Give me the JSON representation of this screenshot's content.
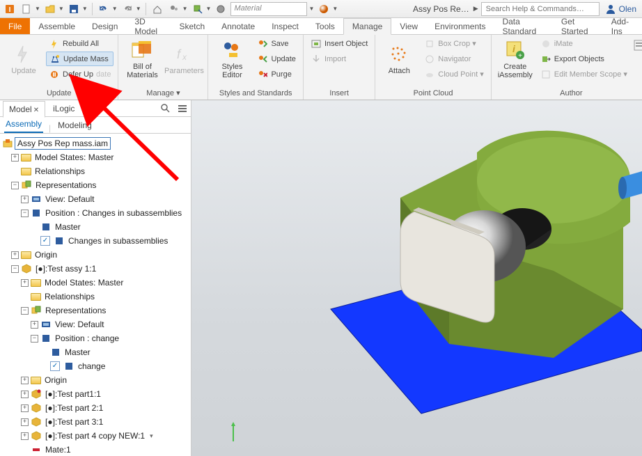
{
  "qat": {
    "material_placeholder": "Material",
    "doc_name": "Assy Pos Re…",
    "search_placeholder": "Search Help & Commands…",
    "user_name": "Olen"
  },
  "tabs": {
    "file": "File",
    "list": [
      "Assemble",
      "Design",
      "3D Model",
      "Sketch",
      "Annotate",
      "Inspect",
      "Tools",
      "Manage",
      "View",
      "Environments",
      "Data Standard",
      "Get Started",
      "Add-Ins"
    ],
    "active": "Manage"
  },
  "ribbon": {
    "update": {
      "big": "Update",
      "rebuild_all": "Rebuild All",
      "update_mass": "Update Mass",
      "defer_update": "Defer Up",
      "group": "Update"
    },
    "manage": {
      "bom": "Bill of\nMaterials",
      "params": "Parameters",
      "group": "Manage ▾"
    },
    "styles": {
      "editor": "Styles Editor",
      "save": "Save",
      "update": "Update",
      "purge": "Purge",
      "group": "Styles and Standards"
    },
    "insert": {
      "insert_obj": "Insert Object",
      "import": "Import",
      "group": "Insert"
    },
    "pointcloud": {
      "attach": "Attach",
      "box_crop": "Box Crop ▾",
      "navigator": "Navigator",
      "cloud_point": "Cloud Point ▾",
      "group": "Point Cloud"
    },
    "author": {
      "create": "Create\niAssembly",
      "imate": "iMate",
      "export": "Export Objects",
      "edit_scope": "Edit Member Scope ▾",
      "group": "Author"
    }
  },
  "browser": {
    "tab_model": "Model",
    "tab_ilogic": "iLogic",
    "subtab_assembly": "Assembly",
    "subtab_modeling": "Modeling"
  },
  "tree": {
    "root": "Assy Pos Rep mass.iam",
    "model_states": "Model States: Master",
    "relationships": "Relationships",
    "representations": "Representations",
    "view_default": "View: Default",
    "position_changes": "Position : Changes in subassemblies",
    "master": "Master",
    "changes_sub": "Changes in subassemblies",
    "origin": "Origin",
    "test_assy": "[●]:Test assy 1:1",
    "sub_model_states": "Model States: Master",
    "sub_relationships": "Relationships",
    "sub_representations": "Representations",
    "sub_view_default": "View: Default",
    "sub_position_change": "Position : change",
    "sub_master": "Master",
    "sub_change": "change",
    "sub_origin": "Origin",
    "test_part1": "[●]:Test part1:1",
    "test_part2": "[●]:Test part 2:1",
    "test_part3": "[●]:Test part 3:1",
    "test_part4": "[●]:Test part 4 copy NEW:1",
    "mate1": "Mate:1"
  }
}
